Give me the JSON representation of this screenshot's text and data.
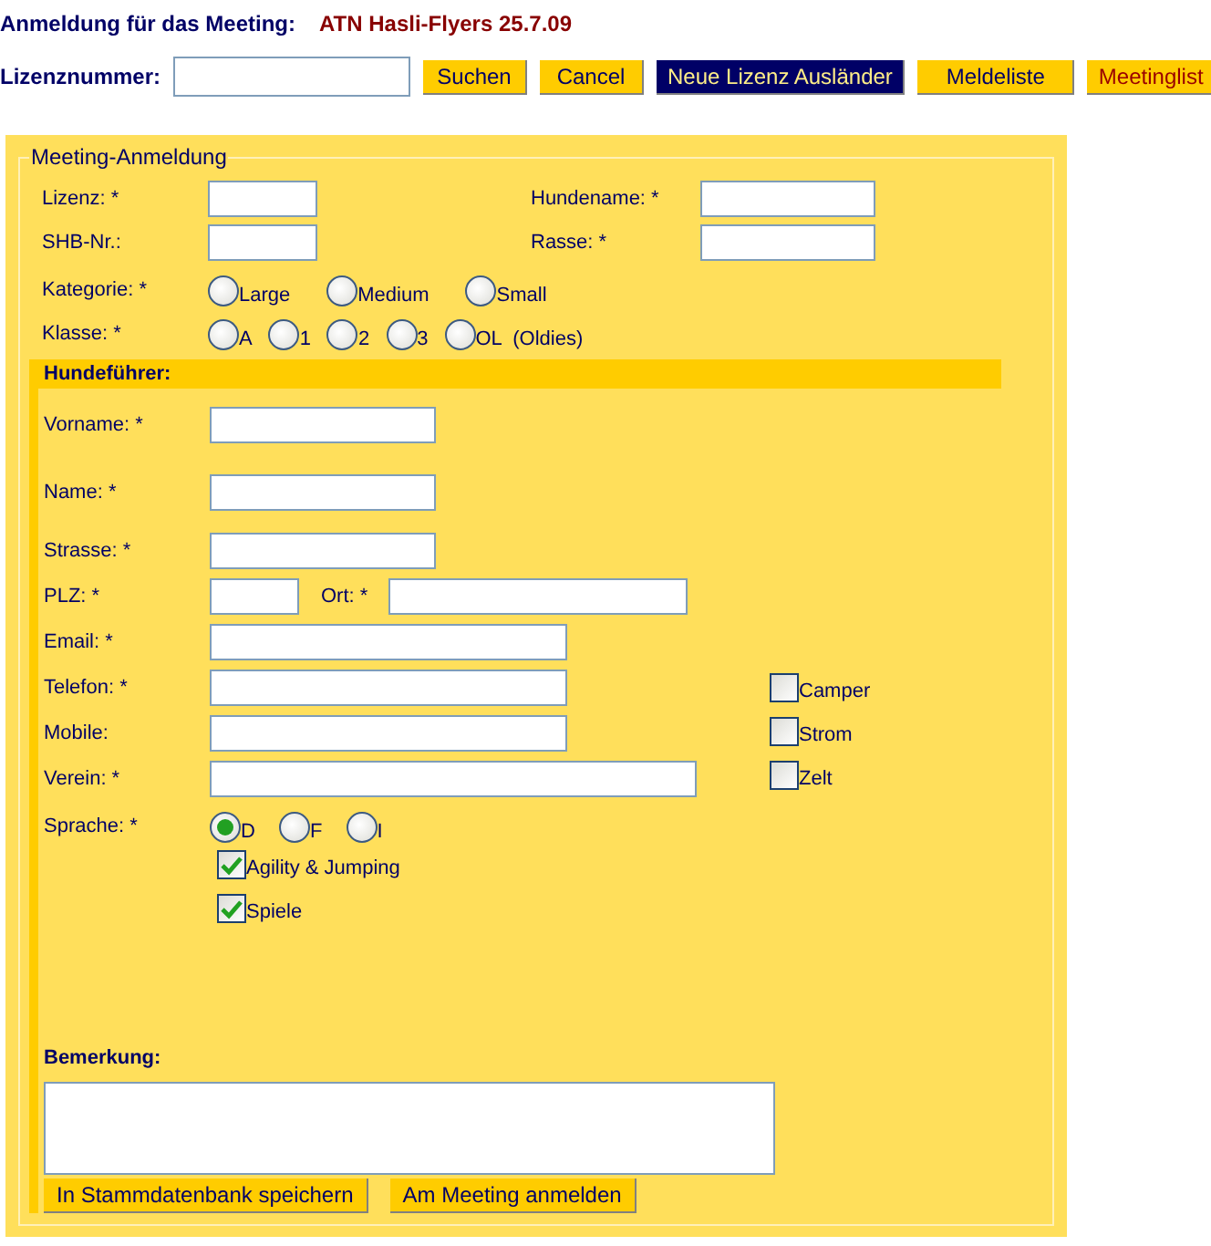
{
  "header": {
    "title": "Anmeldung für das Meeting:",
    "event": "ATN Hasli-Flyers 25.7.09"
  },
  "search": {
    "label": "Lizenznummer:",
    "buttons": [
      {
        "label": "Suchen",
        "kind": "normal"
      },
      {
        "label": "Cancel",
        "kind": "normal"
      },
      {
        "label": "Neue Lizenz Ausländer",
        "kind": "dark"
      },
      {
        "label": "Meldeliste",
        "kind": "normal"
      },
      {
        "label": "Meetinglist",
        "kind": "red"
      }
    ]
  },
  "form": {
    "legend": "Meeting-Anmeldung",
    "dog_fields": [
      {
        "label": "Lizenz: *"
      },
      {
        "label": "Hundename: *"
      },
      {
        "label": "SHB-Nr.:"
      },
      {
        "label": "Rasse: *"
      }
    ],
    "kategorie": {
      "label": "Kategorie: *",
      "options": [
        {
          "label": "Large",
          "selected": false
        },
        {
          "label": "Medium",
          "selected": false
        },
        {
          "label": "Small",
          "selected": false
        }
      ]
    },
    "klasse": {
      "label": "Klasse: *",
      "options": [
        {
          "label": "A",
          "selected": false
        },
        {
          "label": "1",
          "selected": false
        },
        {
          "label": "2",
          "selected": false
        },
        {
          "label": "3",
          "selected": false
        },
        {
          "label": "OL  (Oldies)",
          "selected": false
        }
      ]
    },
    "handler": {
      "heading": "Hundeführer:",
      "fields": [
        {
          "label": "Vorname: *",
          "kind": "medium"
        },
        {
          "label": "Name: *",
          "kind": "medium"
        },
        {
          "label": "Strasse: *",
          "kind": "medium"
        },
        {
          "label": "PLZ: *",
          "kind": "pair",
          "second_label": "Ort: *"
        },
        {
          "label": "Email: *",
          "kind": "long"
        },
        {
          "label": "Telefon: *",
          "kind": "long"
        },
        {
          "label": "Mobile:",
          "kind": "long"
        },
        {
          "label": "Verein: *",
          "kind": "wide"
        }
      ],
      "extras": [
        {
          "label": "Camper",
          "checked": false
        },
        {
          "label": "Strom",
          "checked": false
        },
        {
          "label": "Zelt",
          "checked": false
        }
      ],
      "sprache": {
        "label": "Sprache: *",
        "options": [
          {
            "label": "D",
            "selected": true
          },
          {
            "label": "F",
            "selected": false
          },
          {
            "label": "I",
            "selected": false
          }
        ]
      },
      "disciplines": [
        {
          "label": "Agility & Jumping",
          "checked": true
        },
        {
          "label": "Spiele",
          "checked": true
        }
      ],
      "remark": {
        "label": "Bemerkung:"
      },
      "actions": [
        "In Stammdatenbank speichern",
        "Am Meeting anmelden"
      ]
    }
  }
}
